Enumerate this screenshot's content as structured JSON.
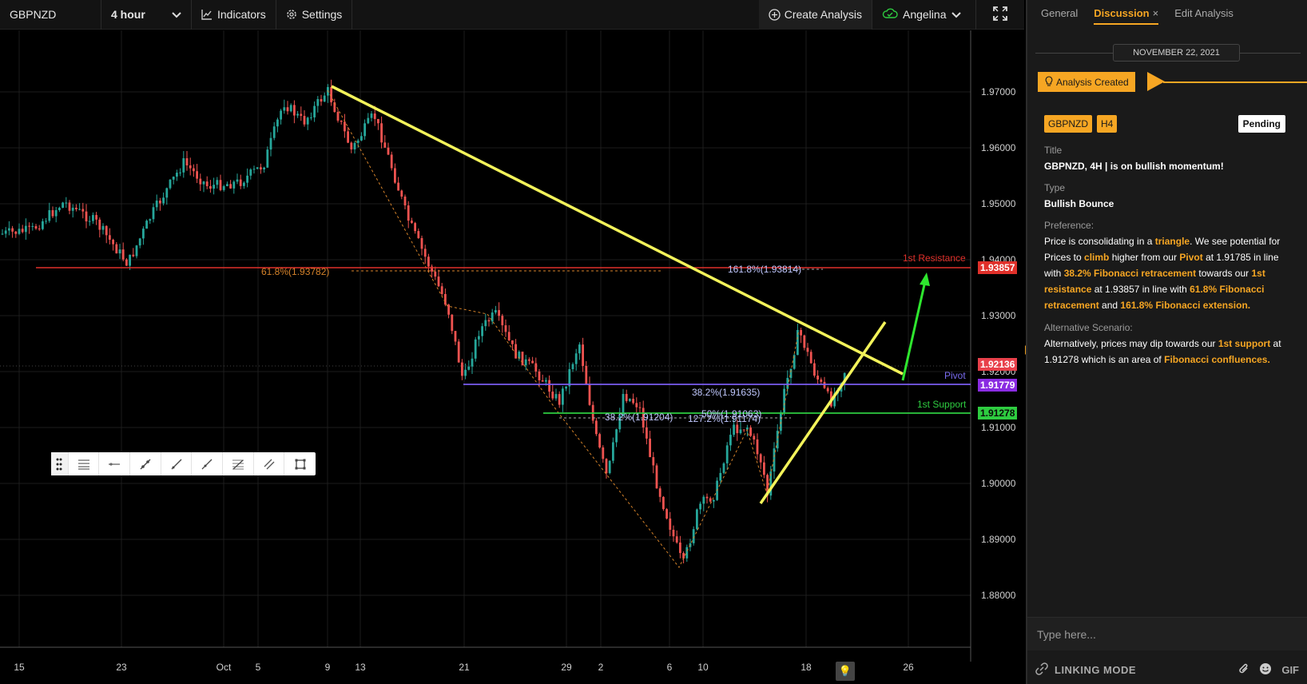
{
  "toolbar": {
    "symbol": "GBPNZD",
    "interval": "4 hour",
    "indicators_label": "Indicators",
    "settings_label": "Settings",
    "create_analysis_label": "Create Analysis",
    "user_name": "Angelina"
  },
  "chart": {
    "price_axis": [
      "1.97000",
      "1.96000",
      "1.95000",
      "1.94000",
      "1.93000",
      "1.92000",
      "1.91000",
      "1.90000",
      "1.89000",
      "1.88000"
    ],
    "date_axis": [
      "15",
      "23",
      "Oct",
      "5",
      "9",
      "13",
      "21",
      "29",
      "2",
      "6",
      "10",
      "18",
      "26"
    ],
    "tags": {
      "resistance": "1.93857",
      "current": "1.92136",
      "pivot": "1.91779",
      "support": "1.91278"
    },
    "line_labels": {
      "resistance": "1st Resistance",
      "pivot": "Pivot",
      "support": "1st Support"
    },
    "fib_labels": {
      "fib_618": "61.8%(1.93782)",
      "fib_1618": "161.8%(1.93814)",
      "fib_382_a": "38.2%(1.91635)",
      "fib_382_b": "38.2%(1.91204)",
      "fib_50": "50%(1.91063)",
      "fib_1272": "127.2%(1.91174)"
    },
    "colors": {
      "resistance": "#e0302a",
      "pivot": "#7a5cf0",
      "support": "#2ecc40",
      "trendline": "#f3f35a",
      "arrow": "#2ee62e",
      "bull": "#26a69a",
      "bear": "#ef5350",
      "fib_dash": "#d4822a"
    }
  },
  "draw_tools": [
    "drag-handle",
    "horizontal-lines",
    "horizontal-ray",
    "trend-line",
    "line",
    "ray",
    "fib-levels",
    "parallel-channel",
    "rectangle"
  ],
  "panel": {
    "tabs": [
      "General",
      "Discussion",
      "Edit Analysis"
    ],
    "date": "NOVEMBER 22, 2021",
    "event": "Analysis Created",
    "badges": [
      "GBPNZD",
      "H4"
    ],
    "status": "Pending",
    "title_label": "Title",
    "title_value": "GBPNZD, 4H | is on bullish momentum!",
    "type_label": "Type",
    "type_value": "Bullish Bounce",
    "preference_label": "Preference:",
    "preference_parts": [
      {
        "t": "Price is consolidating in a ",
        "h": false
      },
      {
        "t": "triangle",
        "h": true
      },
      {
        "t": ". We see potential for Prices to ",
        "h": false
      },
      {
        "t": "climb",
        "h": true
      },
      {
        "t": " higher from our ",
        "h": false
      },
      {
        "t": "Pivot",
        "h": true
      },
      {
        "t": " at 1.91785 in line with ",
        "h": false
      },
      {
        "t": "38.2% Fibonacci retracement",
        "h": true
      },
      {
        "t": " towards our ",
        "h": false
      },
      {
        "t": "1st resistance",
        "h": true
      },
      {
        "t": " at 1.93857 in line with ",
        "h": false
      },
      {
        "t": "61.8% Fibonacci retracement",
        "h": true
      },
      {
        "t": " and ",
        "h": false
      },
      {
        "t": "161.8% Fibonacci extension.",
        "h": true
      }
    ],
    "alt_label": "Alternative Scenario:",
    "alt_parts": [
      {
        "t": "Alternatively, prices may dip towards our ",
        "h": false
      },
      {
        "t": "1st support",
        "h": true
      },
      {
        "t": " at 1.91278 which is an area of ",
        "h": false
      },
      {
        "t": "Fibonacci confluences.",
        "h": true
      }
    ],
    "input_placeholder": "Type here...",
    "linking_mode": "LINKING MODE",
    "gif_label": "GIF"
  }
}
